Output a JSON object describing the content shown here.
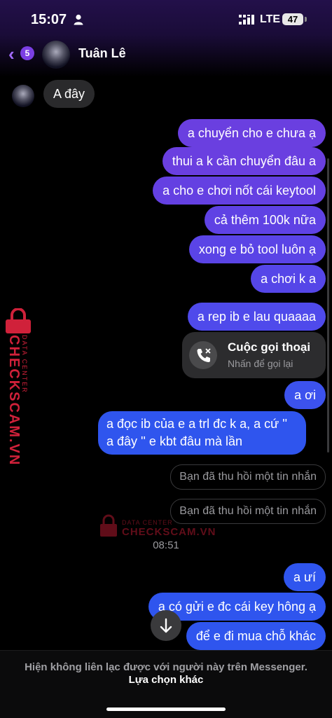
{
  "status_bar": {
    "time": "15:07",
    "network": "LTE",
    "battery": "47"
  },
  "header": {
    "back_badge": "5",
    "contact_name": "Tuân Lê"
  },
  "incoming": [
    {
      "text": "A đây"
    }
  ],
  "outgoing": [
    {
      "text": "a chuyển cho e chưa ạ"
    },
    {
      "text": "thui a k cần chuyển đâu a"
    },
    {
      "text": "a cho e chơi nốt cái keytool"
    },
    {
      "text": "cả thêm 100k nữa"
    },
    {
      "text": "xong e bỏ tool luôn ạ"
    },
    {
      "text": "a chơi k a"
    },
    {
      "text": "a rep ib e lau quaaaa"
    },
    {
      "text": "a ơi"
    },
    {
      "text": "a đọc ib của e a trl đc k a, a cứ '' a đây '' e kbt đâu mà lần"
    },
    {
      "text": "a ưí"
    },
    {
      "text": "a có gửi e đc cái key hông ạ"
    },
    {
      "text": "để e đi mua chỗ khác"
    }
  ],
  "call_card": {
    "title": "Cuộc gọi thoại",
    "subtitle": "Nhấn để gọi lại"
  },
  "recalled": [
    {
      "text": "Bạn đã thu hồi một tin nhắn"
    },
    {
      "text": "Bạn đã thu hồi một tin nhắn"
    }
  ],
  "timestamp": "08:51",
  "bottom_bar": {
    "notice": "Hiện không liên lạc được với người này trên Messenger.",
    "action": "Lựa chọn khác"
  },
  "watermark": {
    "brand": "CHECKSCAM.VN",
    "sub": "DATA CENTER"
  },
  "colors": {
    "purple_bubble": "#6a3fe0",
    "blue_bubble": "#2f55ee",
    "accent": "#a26bff"
  }
}
